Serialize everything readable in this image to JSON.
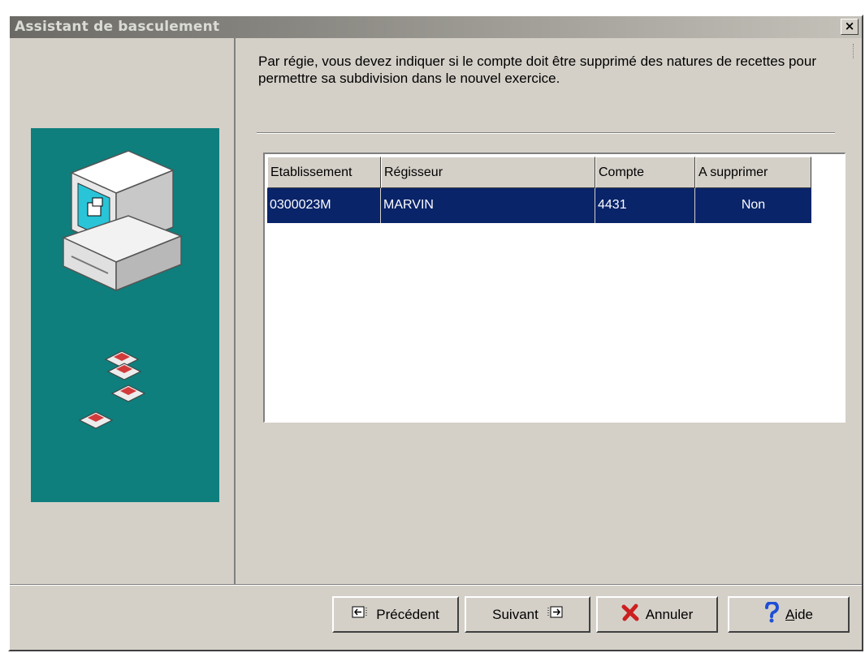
{
  "window": {
    "title": "Assistant de basculement",
    "close_glyph": "×"
  },
  "instruction": "Par régie, vous devez indiquer si le compte doit être supprimé des natures de recettes pour permettre sa subdivision dans le nouvel exercice.",
  "table": {
    "columns": [
      "Etablissement",
      "Régisseur",
      "Compte",
      "A supprimer"
    ],
    "rows": [
      [
        "0300023M",
        "MARVIN",
        "4431",
        "Non"
      ]
    ],
    "selected_row": 0
  },
  "buttons": {
    "previous": {
      "label": "Précédent",
      "icon": "arrow-left-icon"
    },
    "next": {
      "label": "Suivant",
      "icon": "arrow-right-icon"
    },
    "cancel": {
      "label": "Annuler",
      "icon": "red-x-icon"
    },
    "help": {
      "label_accel": "A",
      "label_rest": "ide",
      "icon": "question-mark-icon"
    }
  },
  "colors": {
    "selection": "#0a246a",
    "side_panel": "#0e7f7d",
    "face": "#d4d0c8"
  }
}
